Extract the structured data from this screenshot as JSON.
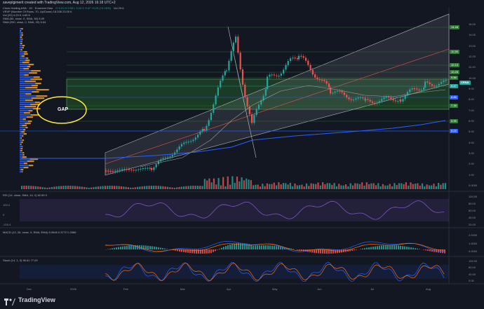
{
  "header": {
    "credit": "saveplgimerit created with TradingView.com, Aug 12, 2026 16:18 UTC+2",
    "symbol_line": "Circio Holding ASA · 1D · Euronext Oslo",
    "ohlc": "O 9.21  H 9.55  L 9.10  C 9.47  +0.29 (+3.16%)",
    "vol_label": "Vol 29.6"
  },
  "legends": {
    "vrvp": "VRVP (Number Of Rows, 70, Up/Down)  18.028  23.05 K",
    "vol": "Vol (20)  4.29 K  4.65 K",
    "sma50": "SMA (50, close, 0, SMA, 50)  8.09",
    "sma200": "SMA (200, close, 0, SMA, 20)  5.54"
  },
  "annotations": {
    "gap": "GAP"
  },
  "price_axis": [
    "16.00",
    "14.00",
    "13.00",
    "12.00",
    "11.00",
    "10.00",
    "9.00",
    "8.00",
    "7.00",
    "6.00",
    "5.00",
    "4.00",
    "3.00",
    "2.00",
    "1.00",
    "0.0000"
  ],
  "price_badges": [
    {
      "label": "14.48",
      "color": "#2e7d32"
    },
    {
      "label": "11.28",
      "color": "#2e7d32"
    },
    {
      "label": "10.10",
      "color": "#2e7d32"
    },
    {
      "label": "10.28",
      "color": "#2e7d32"
    },
    {
      "label": "9.86",
      "color": "#2e7d32"
    },
    {
      "label": "9.47",
      "color": "#26a69a"
    },
    {
      "label": "8.85",
      "color": "#2962ff"
    },
    {
      "label": "7.38",
      "color": "#2e7d32"
    },
    {
      "label": "5.95",
      "color": "#2e7d32"
    },
    {
      "label": "5.02",
      "color": "#2962ff"
    }
  ],
  "symbol_badge": "CRNA",
  "dates": [
    "Dec",
    "2026",
    "Feb",
    "Mar",
    "Apr",
    "May",
    "Jun",
    "Jul",
    "Aug"
  ],
  "rsi": {
    "label": "RSI (14, close, SMA, 14, 2)  62.65  0",
    "axis": [
      "100.00",
      "80.00",
      "60.00",
      "40.00",
      "20.00"
    ],
    "left_axis": [
      "100.4",
      "0",
      "-100.4"
    ]
  },
  "macd": {
    "label": "MACD (12, 26, close, 9, EMA, EMA)  0.0646  0.3772  0.2086",
    "axis": [
      "2.0000",
      "1.0000",
      "0.0000"
    ]
  },
  "stoch": {
    "label": "Stoch (14, 1, 3)  96.61  77.09",
    "axis": [
      "100.00",
      "80.00",
      "40.00",
      "0.00"
    ]
  },
  "footer": {
    "brand": "TradingView"
  },
  "colors": {
    "bg": "#131722",
    "up": "#26a69a",
    "down": "#ef5350",
    "zone": "#2e7d32",
    "channel": "#787b86",
    "sma": "#2962ff"
  }
}
